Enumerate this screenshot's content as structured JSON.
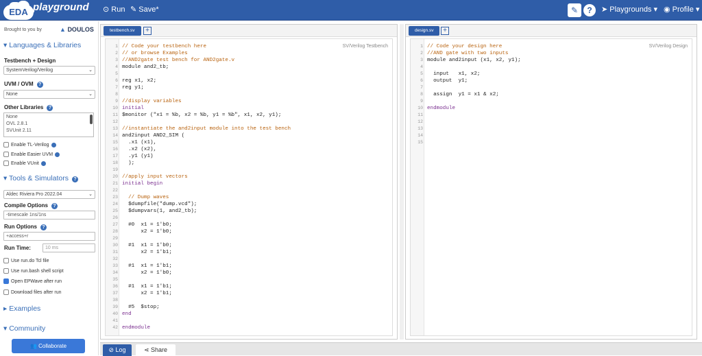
{
  "header": {
    "logo_badge": "EDA",
    "logo_text": "playground",
    "run_label": "Run",
    "save_label": "Save*",
    "help_label": "?",
    "playgrounds_label": "Playgrounds ▾",
    "profile_label": "Profile ▾"
  },
  "sidebar": {
    "brought_by": "Brought to you by",
    "sponsor": "DOULOS",
    "languages_section": "Languages & Libraries",
    "testbench_label": "Testbench + Design",
    "testbench_value": "SystemVerilog/Verilog",
    "uvm_label": "UVM / OVM",
    "uvm_value": "None",
    "other_libs_label": "Other Libraries",
    "other_libs": [
      "None",
      "OVL 2.8.1",
      "SVUnit 2.11"
    ],
    "enable_tl": "Enable TL-Verilog",
    "enable_easier_uvm": "Enable Easier UVM",
    "enable_vunit": "Enable VUnit",
    "tools_section": "Tools & Simulators",
    "simulator_value": "Aldec Riviera Pro 2022.04",
    "compile_label": "Compile Options",
    "compile_value": "-timescale 1ns/1ns",
    "run_options_label": "Run Options",
    "run_options_value": "+access+r",
    "run_time_label": "Run Time:",
    "run_time_placeholder": "10 ms",
    "use_rundo": "Use run.do Tcl file",
    "use_runbash": "Use run.bash shell script",
    "open_epwave": "Open EPWave after run",
    "download_files": "Download files after run",
    "examples_section": "Examples",
    "community_section": "Community",
    "collaborate_label": "Collaborate"
  },
  "left_editor": {
    "tab": "testbench.sv",
    "lang": "SV/Verilog Testbench",
    "lines": [
      {
        "n": "1",
        "t": "// Code your testbench here",
        "c": "cm"
      },
      {
        "n": "2",
        "t": "// or browse Examples",
        "c": "cm"
      },
      {
        "n": "3",
        "t": "//AND2gate test bench for AND2gate.v",
        "c": "cm"
      },
      {
        "n": "4",
        "t": "module and2_tb;",
        "c": ""
      },
      {
        "n": "5",
        "t": "",
        "c": ""
      },
      {
        "n": "6",
        "t": "reg x1, x2;",
        "c": ""
      },
      {
        "n": "7",
        "t": "reg y1;",
        "c": ""
      },
      {
        "n": "8",
        "t": "",
        "c": ""
      },
      {
        "n": "9",
        "t": "//display variables",
        "c": "cm"
      },
      {
        "n": "10",
        "t": "initial",
        "c": "kw"
      },
      {
        "n": "11",
        "t": "$monitor (\"x1 = %b, x2 = %b, y1 = %b\", x1, x2, y1);",
        "c": ""
      },
      {
        "n": "12",
        "t": "",
        "c": ""
      },
      {
        "n": "13",
        "t": "//instantiate the and2input module into the test bench",
        "c": "cm"
      },
      {
        "n": "14",
        "t": "and2input AND2_SIM (",
        "c": ""
      },
      {
        "n": "15",
        "t": "  .x1 (x1),",
        "c": ""
      },
      {
        "n": "16",
        "t": "  .x2 (x2),",
        "c": ""
      },
      {
        "n": "17",
        "t": "  .y1 (y1)",
        "c": ""
      },
      {
        "n": "18",
        "t": "  );",
        "c": ""
      },
      {
        "n": "19",
        "t": "",
        "c": ""
      },
      {
        "n": "20",
        "t": "//apply input vectors",
        "c": "cm"
      },
      {
        "n": "21",
        "t": "initial begin",
        "c": "kw"
      },
      {
        "n": "22",
        "t": "",
        "c": ""
      },
      {
        "n": "23",
        "t": "  // Dump waves",
        "c": "cm"
      },
      {
        "n": "24",
        "t": "  $dumpfile(\"dump.vcd\");",
        "c": ""
      },
      {
        "n": "25",
        "t": "  $dumpvars(1, and2_tb);",
        "c": ""
      },
      {
        "n": "26",
        "t": "",
        "c": ""
      },
      {
        "n": "27",
        "t": "  #0  x1 = 1'b0;",
        "c": ""
      },
      {
        "n": "28",
        "t": "      x2 = 1'b0;",
        "c": ""
      },
      {
        "n": "29",
        "t": "",
        "c": ""
      },
      {
        "n": "30",
        "t": "  #1  x1 = 1'b0;",
        "c": ""
      },
      {
        "n": "31",
        "t": "      x2 = 1'b1;",
        "c": ""
      },
      {
        "n": "32",
        "t": "",
        "c": ""
      },
      {
        "n": "33",
        "t": "  #1  x1 = 1'b1;",
        "c": ""
      },
      {
        "n": "34",
        "t": "      x2 = 1'b0;",
        "c": ""
      },
      {
        "n": "35",
        "t": "",
        "c": ""
      },
      {
        "n": "36",
        "t": "  #1  x1 = 1'b1;",
        "c": ""
      },
      {
        "n": "37",
        "t": "      x2 = 1'b1;",
        "c": ""
      },
      {
        "n": "38",
        "t": "",
        "c": ""
      },
      {
        "n": "39",
        "t": "  #5  $stop;",
        "c": ""
      },
      {
        "n": "40",
        "t": "end",
        "c": "kw"
      },
      {
        "n": "41",
        "t": "",
        "c": ""
      },
      {
        "n": "42",
        "t": "endmodule",
        "c": "kw"
      }
    ]
  },
  "right_editor": {
    "tab": "design.sv",
    "lang": "SV/Verilog Design",
    "lines": [
      {
        "n": "1",
        "t": "// Code your design here",
        "c": "cm"
      },
      {
        "n": "2",
        "t": "//AND gate with two inputs",
        "c": "cm"
      },
      {
        "n": "3",
        "t": "module and2input (x1, x2, y1);",
        "c": ""
      },
      {
        "n": "4",
        "t": "",
        "c": ""
      },
      {
        "n": "5",
        "t": "  input   x1, x2;",
        "c": ""
      },
      {
        "n": "6",
        "t": "  output  y1;",
        "c": ""
      },
      {
        "n": "7",
        "t": "",
        "c": ""
      },
      {
        "n": "8",
        "t": "  assign  y1 = x1 & x2;",
        "c": ""
      },
      {
        "n": "9",
        "t": "",
        "c": ""
      },
      {
        "n": "10",
        "t": "endmodule",
        "c": "kw"
      },
      {
        "n": "11",
        "t": "",
        "c": ""
      },
      {
        "n": "12",
        "t": "",
        "c": ""
      },
      {
        "n": "13",
        "t": "",
        "c": ""
      },
      {
        "n": "14",
        "t": "",
        "c": ""
      },
      {
        "n": "15",
        "t": "",
        "c": ""
      }
    ]
  },
  "bottom": {
    "log_label": "Log",
    "share_label": "Share"
  }
}
